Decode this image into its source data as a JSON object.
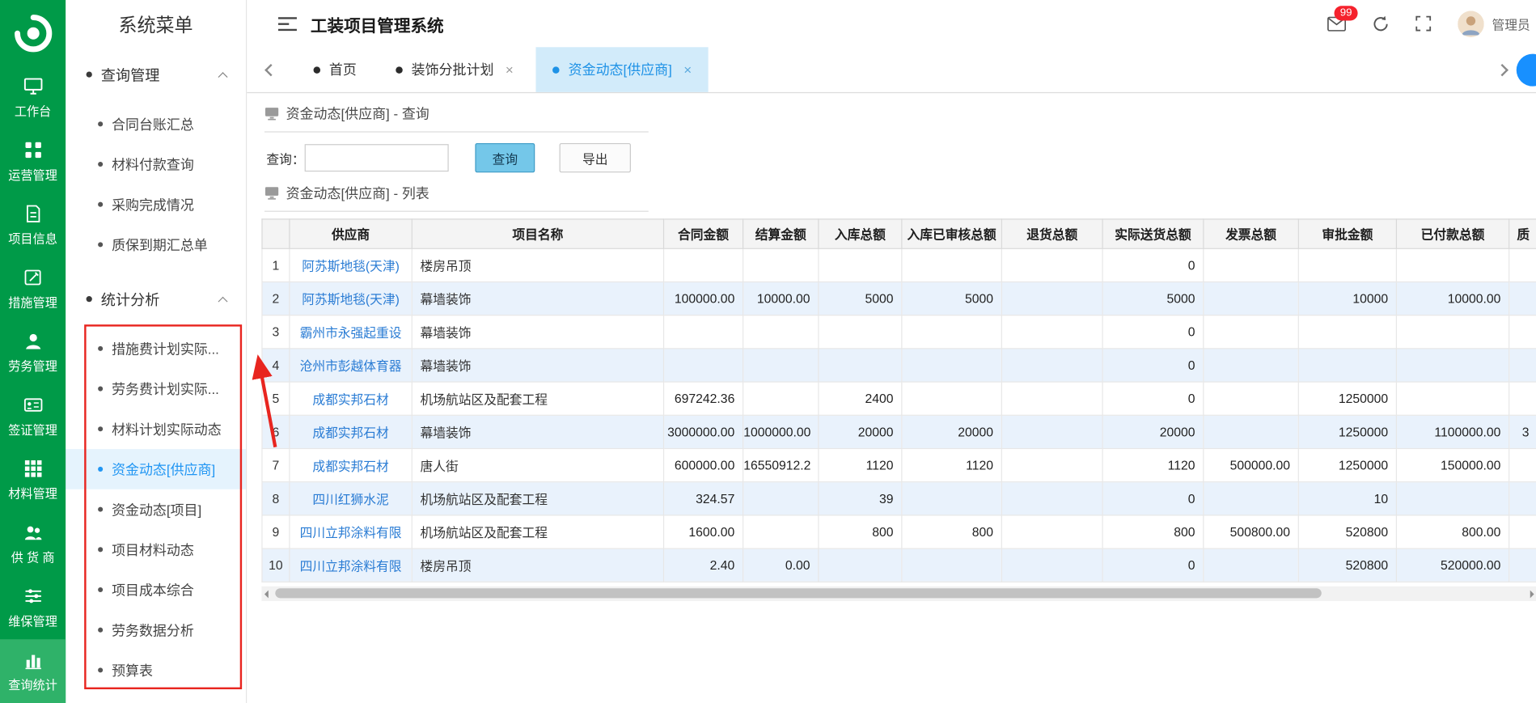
{
  "app": {
    "title": "工装项目管理系统",
    "user": "管理员",
    "mail_badge": "99"
  },
  "colors": {
    "rail_green": "#009a48",
    "accent_blue": "#1890ff",
    "annotation_red": "#e8251f",
    "stripe_blue": "#e9f2fc"
  },
  "rail": {
    "items": [
      {
        "label": "工作台"
      },
      {
        "label": "运营管理"
      },
      {
        "label": "项目信息"
      },
      {
        "label": "措施管理"
      },
      {
        "label": "劳务管理"
      },
      {
        "label": "签证管理"
      },
      {
        "label": "材料管理"
      },
      {
        "label": "供 货 商"
      },
      {
        "label": "维保管理"
      },
      {
        "label": "查询统计"
      }
    ]
  },
  "menu": {
    "title": "系统菜单",
    "sections": [
      {
        "label": "查询管理",
        "items": [
          {
            "label": "合同台账汇总"
          },
          {
            "label": "材料付款查询"
          },
          {
            "label": "采购完成情况"
          },
          {
            "label": "质保到期汇总单"
          }
        ]
      },
      {
        "label": "统计分析",
        "items": [
          {
            "label": "措施费计划实际..."
          },
          {
            "label": "劳务费计划实际..."
          },
          {
            "label": "材料计划实际动态"
          },
          {
            "label": "资金动态[供应商]"
          },
          {
            "label": "资金动态[项目]"
          },
          {
            "label": "项目材料动态"
          },
          {
            "label": "项目成本综合"
          },
          {
            "label": "劳务数据分析"
          },
          {
            "label": "预算表"
          }
        ]
      }
    ]
  },
  "tabs": [
    {
      "label": "首页"
    },
    {
      "label": "装饰分批计划",
      "close": "×"
    },
    {
      "label": "资金动态[供应商]",
      "close": "×"
    }
  ],
  "query_panel": {
    "title": "资金动态[供应商] - 查询",
    "search_label": "查询：",
    "search_value": "",
    "buttons": {
      "search": "查询",
      "export": "导出"
    }
  },
  "list_panel": {
    "title": "资金动态[供应商] - 列表",
    "columns": [
      "供应商",
      "项目名称",
      "合同金额",
      "结算金额",
      "入库总额",
      "入库已审核总额",
      "退货总额",
      "实际送货总额",
      "发票总额",
      "审批金额",
      "已付款总额",
      "质"
    ],
    "rows": [
      [
        "阿苏斯地毯(天津)",
        "楼房吊顶",
        "",
        "",
        "",
        "",
        "",
        "0",
        "",
        "",
        "",
        ""
      ],
      [
        "阿苏斯地毯(天津)",
        "幕墙装饰",
        "100000.00",
        "10000.00",
        "5000",
        "5000",
        "",
        "5000",
        "",
        "10000",
        "10000.00",
        ""
      ],
      [
        "霸州市永强起重设",
        "幕墙装饰",
        "",
        "",
        "",
        "",
        "",
        "0",
        "",
        "",
        "",
        ""
      ],
      [
        "沧州市彭越体育器",
        "幕墙装饰",
        "",
        "",
        "",
        "",
        "",
        "0",
        "",
        "",
        "",
        ""
      ],
      [
        "成都实邦石材",
        "机场航站区及配套工程",
        "697242.36",
        "",
        "2400",
        "",
        "",
        "0",
        "",
        "1250000",
        "",
        ""
      ],
      [
        "成都实邦石材",
        "幕墙装饰",
        "3000000.00",
        "1000000.00",
        "20000",
        "20000",
        "",
        "20000",
        "",
        "1250000",
        "1100000.00",
        "3"
      ],
      [
        "成都实邦石材",
        "唐人街",
        "600000.00",
        "16550912.2",
        "1120",
        "1120",
        "",
        "1120",
        "500000.00",
        "1250000",
        "150000.00",
        ""
      ],
      [
        "四川红狮水泥",
        "机场航站区及配套工程",
        "324.57",
        "",
        "39",
        "",
        "",
        "0",
        "",
        "10",
        "",
        ""
      ],
      [
        "四川立邦涂料有限",
        "机场航站区及配套工程",
        "1600.00",
        "",
        "800",
        "800",
        "",
        "800",
        "500800.00",
        "520800",
        "800.00",
        ""
      ],
      [
        "四川立邦涂料有限",
        "楼房吊顶",
        "2.40",
        "0.00",
        "",
        "",
        "",
        "0",
        "",
        "520800",
        "520000.00",
        ""
      ]
    ]
  }
}
